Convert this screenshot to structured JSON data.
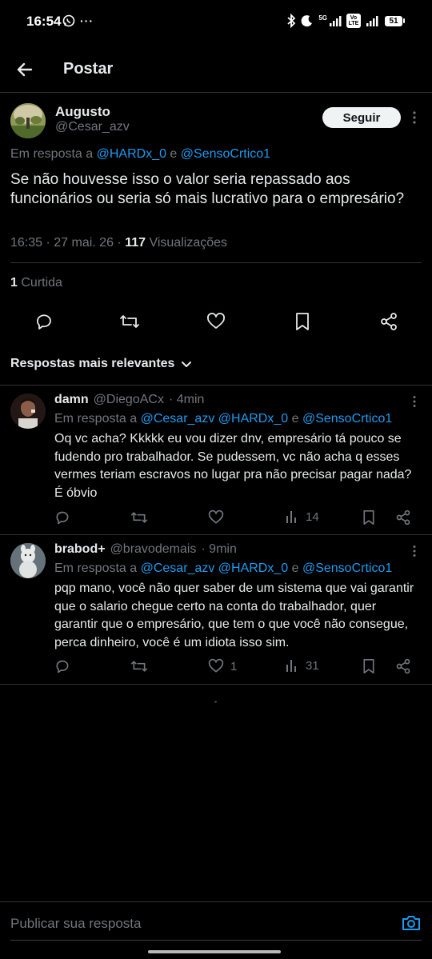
{
  "status_bar": {
    "time": "16:54",
    "network_label": "5G",
    "volte_label": "Vo LTE",
    "battery": "51"
  },
  "header": {
    "title": "Postar"
  },
  "main_post": {
    "author_name": "Augusto",
    "author_handle": "@Cesar_azv",
    "follow_label": "Seguir",
    "reply_prefix": "Em resposta a ",
    "reply_user1": "@HARDx_0",
    "reply_and": " e ",
    "reply_user2": "@SensoCrtico1",
    "text": "Se não houvesse isso o valor seria repassado aos funcionários ou seria só mais lucrativo para o empresário?",
    "time": "16:35",
    "date": "27 mai. 26",
    "views_count": "117",
    "views_label": "Visualizações",
    "likes_count": "1",
    "likes_label": "Curtida"
  },
  "sort": {
    "label": "Respostas mais relevantes"
  },
  "replies": [
    {
      "name": "damn",
      "handle": "@DiegoACx",
      "time": "· 4min",
      "reply_prefix": "Em resposta a ",
      "reply_user1": "@Cesar_azv",
      "reply_user2": "@HARDx_0",
      "reply_and": " e ",
      "reply_user3": "@SensoCrtico1",
      "text": "Oq vc acha? Kkkkk eu vou dizer dnv, empresário tá pouco se fudendo pro trabalhador. Se pudessem, vc não acha q esses vermes teriam escravos no lugar pra não precisar pagar nada? É óbvio",
      "likes": "",
      "views": "14"
    },
    {
      "name": "brabod+",
      "handle": "@bravodemais",
      "time": "· 9min",
      "reply_prefix": "Em resposta a ",
      "reply_user1": "@Cesar_azv",
      "reply_user2": "@HARDx_0",
      "reply_and": " e ",
      "reply_user3": "@SensoCrtico1",
      "text": "pqp mano, você não quer saber de um sistema que vai garantir que o salario chegue certo na conta do trabalhador, quer garantir que o empresário, que tem o que você não consegue, perca dinheiro, você é um idiota isso sim.",
      "likes": "1",
      "views": "31"
    }
  ],
  "compose": {
    "placeholder": "Publicar sua resposta"
  },
  "colors": {
    "background": "#000000",
    "text": "#e7e9ea",
    "muted": "#71767b",
    "link": "#1d9bf0",
    "divider": "#2f3336"
  }
}
